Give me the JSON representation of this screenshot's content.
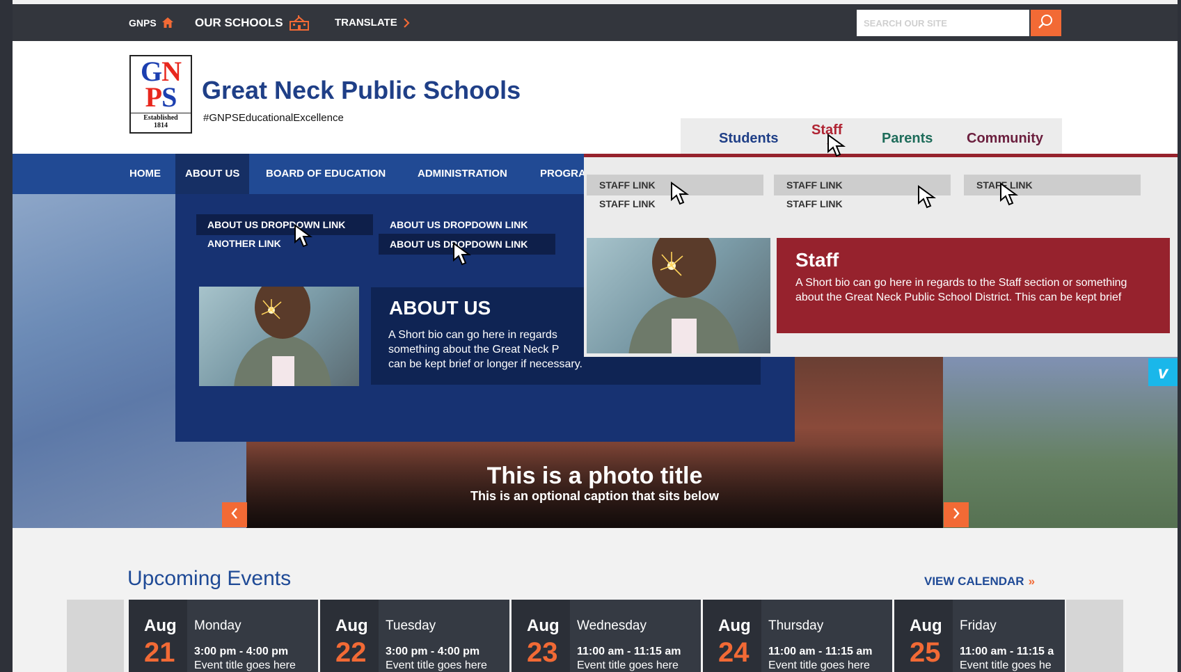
{
  "topbar": {
    "gnps": "GNPS",
    "our_schools": "OUR SCHOOLS",
    "translate": "TRANSLATE",
    "search_placeholder": "SEARCH OUR SITE"
  },
  "header": {
    "site_name": "Great Neck Public Schools",
    "tagline": "#GNPSEducationalExcellence",
    "logo": {
      "line1a": "G",
      "line1b": "N",
      "line2a": "P",
      "line2b": "S",
      "est1": "Established",
      "est2": "1814"
    }
  },
  "audience": {
    "items": [
      {
        "label": "Students",
        "color": "#1f3f87"
      },
      {
        "label": "Staff",
        "color": "#b02433"
      },
      {
        "label": "Parents",
        "color": "#1e6c5a"
      },
      {
        "label": "Community",
        "color": "#6b1f3e"
      }
    ]
  },
  "nav": {
    "items": [
      "HOME",
      "ABOUT US",
      "BOARD OF EDUCATION",
      "ADMINISTRATION",
      "PROGRA"
    ]
  },
  "about_dropdown": {
    "links": [
      "ABOUT US DROPDOWN LINK",
      "ANOTHER LINK",
      "ABOUT US DROPDOWN LINK",
      "ABOUT US DROPDOWN LINK"
    ],
    "title": "ABOUT US",
    "bio_lines": [
      "A Short bio can go here in regards",
      "something about the Great Neck P",
      "can be kept brief or longer if necessary."
    ]
  },
  "staff_dropdown": {
    "links": [
      "STAFF LINK",
      "STAFF LINK",
      "STAFF LINK",
      "STAFF LINK",
      "STAFF LINK"
    ],
    "title": "Staff",
    "bio": "A Short bio can go here in regards to the Staff section or something about the Great Neck Public School District. This can be kept brief"
  },
  "hero": {
    "photo_title": "This is a photo title",
    "photo_caption": "This is an optional caption that sits below",
    "vimeo": "v"
  },
  "events": {
    "title": "Upcoming Events",
    "view_calendar": "VIEW CALENDAR",
    "items": [
      {
        "month": "Aug",
        "day": "21",
        "weekday": "Monday",
        "time": "3:00 pm - 4:00 pm",
        "event": "Event title goes here"
      },
      {
        "month": "Aug",
        "day": "22",
        "weekday": "Tuesday",
        "time": "3:00 pm - 4:00 pm",
        "event": "Event title goes here"
      },
      {
        "month": "Aug",
        "day": "23",
        "weekday": "Wednesday",
        "time": "11:00 am - 11:15 am",
        "event": "Event title goes here"
      },
      {
        "month": "Aug",
        "day": "24",
        "weekday": "Thursday",
        "time": "11:00 am - 11:15 am",
        "event": "Event title goes here"
      },
      {
        "month": "Aug",
        "day": "25",
        "weekday": "Friday",
        "time": "11:00 am - 11:15 a",
        "event": "Event title goes he"
      }
    ]
  },
  "colors": {
    "accent": "#f26a35",
    "nav": "#214a94",
    "staff": "#96222d",
    "topbar": "#33363d"
  }
}
